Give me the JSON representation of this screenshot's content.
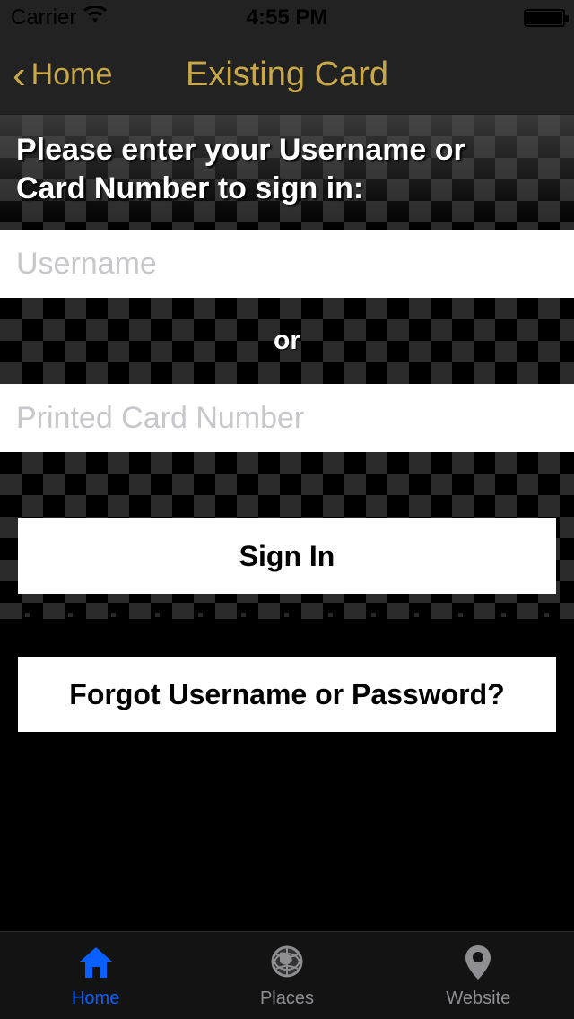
{
  "status": {
    "carrier": "Carrier",
    "time": "4:55 PM"
  },
  "nav": {
    "back_label": "Home",
    "title": "Existing Card"
  },
  "form": {
    "instruction": "Please enter your Username or Card Number to sign in:",
    "username_placeholder": "Username",
    "or_label": "or",
    "card_placeholder": "Printed Card Number",
    "signin_label": "Sign In",
    "forgot_label": "Forgot Username or Password?"
  },
  "tabs": {
    "home": "Home",
    "places": "Places",
    "website": "Website"
  },
  "colors": {
    "accent": "#c9a84a",
    "active_tab": "#0a60ff"
  }
}
